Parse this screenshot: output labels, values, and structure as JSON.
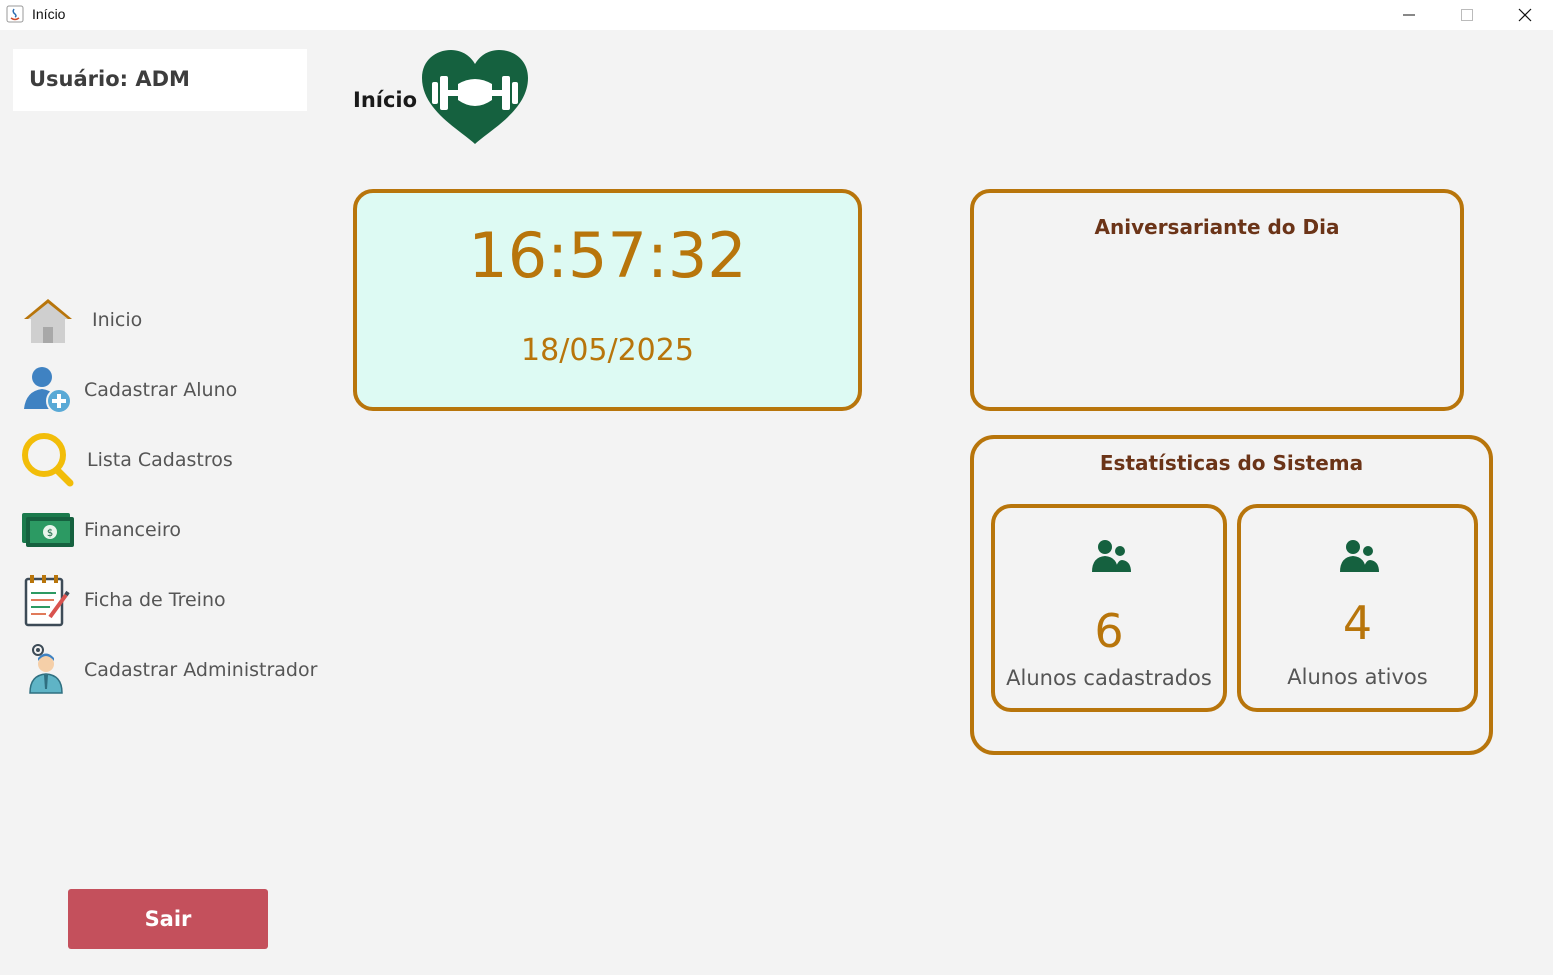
{
  "window": {
    "title": "Início"
  },
  "user_panel": {
    "label": "Usuário: ADM"
  },
  "sidebar": {
    "items": [
      {
        "label": "Inicio",
        "icon": "home-icon"
      },
      {
        "label": "Cadastrar Aluno",
        "icon": "add-user-icon"
      },
      {
        "label": "Lista Cadastros",
        "icon": "search-icon"
      },
      {
        "label": "Financeiro",
        "icon": "money-icon"
      },
      {
        "label": "Ficha de Treino",
        "icon": "notepad-icon"
      },
      {
        "label": "Cadastrar Administrador",
        "icon": "admin-icon"
      }
    ]
  },
  "header": {
    "title": "Início"
  },
  "clock": {
    "time": "16:57:32",
    "date": "18/05/2025"
  },
  "birthday": {
    "heading": "Aniversariante do Dia"
  },
  "stats": {
    "heading": "Estatísticas do Sistema",
    "registered": {
      "value": "6",
      "label": "Alunos cadastrados"
    },
    "active": {
      "value": "4",
      "label": "Alunos ativos"
    }
  },
  "actions": {
    "logout_label": "Sair"
  },
  "colors": {
    "accent": "#b8750b",
    "brand_green": "#15613f",
    "logout": "#c4505c",
    "clock_bg": "#ddfaf3",
    "heading_brown": "#6b3418"
  }
}
